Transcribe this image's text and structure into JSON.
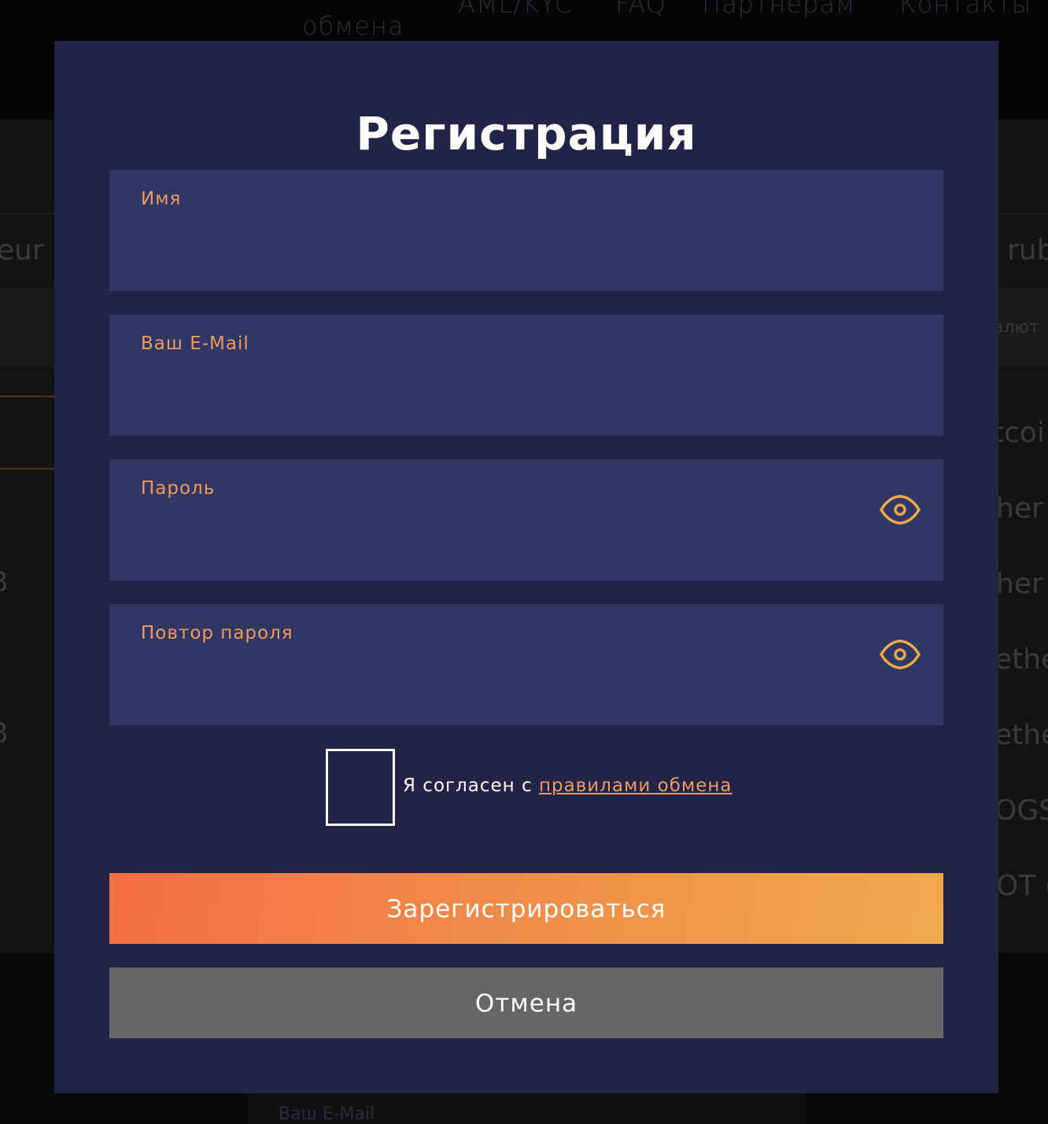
{
  "background": {
    "nav": {
      "item_obmena": "обмена",
      "item_aml": "AML/KYC",
      "item_faq": "FAQ",
      "item_partners": "Партнерам",
      "item_contacts": "Контакты"
    },
    "left_texts": [
      "eur",
      "В",
      "В"
    ],
    "right_texts": [
      "rub",
      "алют",
      "tcoi",
      "her",
      "her",
      "ethe",
      "ethe",
      "OGS",
      "OT ("
    ],
    "bottom_field_label": "Ваш E-Mail"
  },
  "modal": {
    "title": "Регистрация",
    "fields": {
      "name_label": "Имя",
      "email_label": "Ваш E-Mail",
      "password_label": "Пароль",
      "password_repeat_label": "Повтор пароля"
    },
    "agree": {
      "text": "Я согласен с ",
      "link": "правилами обмена"
    },
    "buttons": {
      "register": "Зарегистрироваться",
      "cancel": "Отмена"
    }
  },
  "colors": {
    "modal_bg": "#212447",
    "field_bg": "#313764",
    "label": "#ef9a5e",
    "register_gradient_start": "#f36f45",
    "register_gradient_end": "#eea949",
    "cancel_bg": "#666666"
  },
  "icons": {
    "password_toggle": "eye-icon",
    "password_repeat_toggle": "eye-icon"
  }
}
